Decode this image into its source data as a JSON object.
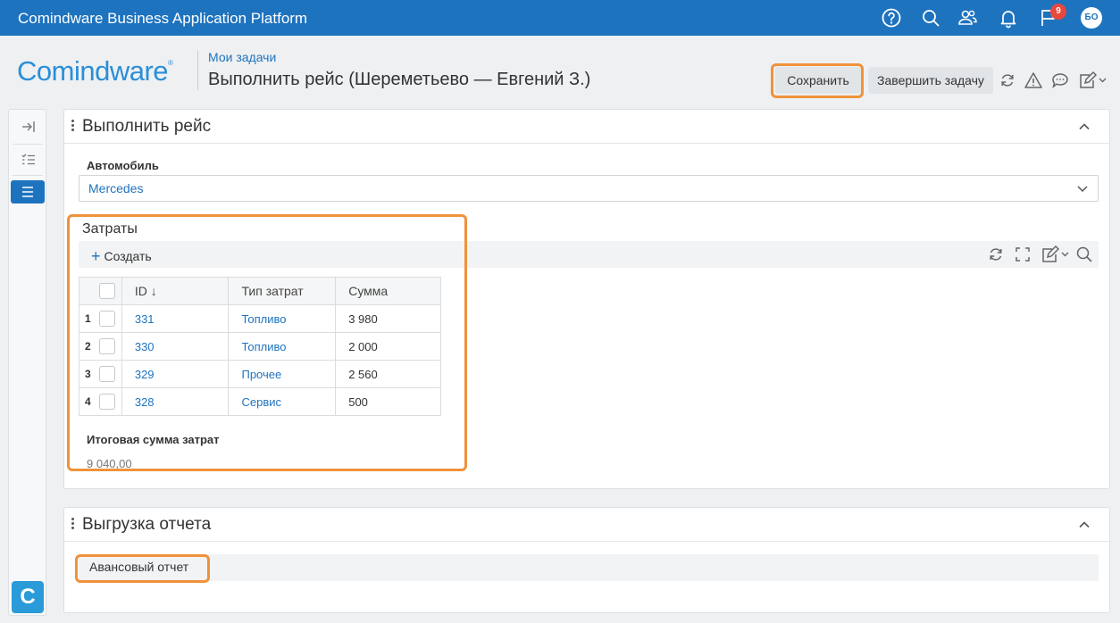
{
  "topbar": {
    "app_title": "Comindware Business Application Platform",
    "icons": [
      "help-icon",
      "search-icon",
      "users-icon",
      "bell-icon",
      "flag-icon"
    ],
    "notification_count": "9",
    "avatar_initials": "БО"
  },
  "header": {
    "logo": "Comindware",
    "breadcrumb": "Мои задачи",
    "title": "Выполнить рейс (Шереметьево — Евгений З.)",
    "save_label": "Сохранить",
    "complete_label": "Завершить задачу"
  },
  "form": {
    "section_title": "Выполнить рейс",
    "car_label": "Автомобиль",
    "car_value": "Mercedes",
    "expenses": {
      "title": "Затраты",
      "create_label": "Создать",
      "columns": [
        "ID",
        "Тип затрат",
        "Сумма"
      ],
      "sort_indicator": "↓",
      "rows": [
        {
          "n": "1",
          "id": "331",
          "type": "Топливо",
          "sum": "3 980"
        },
        {
          "n": "2",
          "id": "330",
          "type": "Топливо",
          "sum": "2 000"
        },
        {
          "n": "3",
          "id": "329",
          "type": "Прочее",
          "sum": "2 560"
        },
        {
          "n": "4",
          "id": "328",
          "type": "Сервис",
          "sum": "500"
        }
      ]
    },
    "total_label": "Итоговая сумма затрат",
    "total_value": "9 040,00"
  },
  "report": {
    "section_title": "Выгрузка отчета",
    "button_label": "Авансовый отчет"
  },
  "colors": {
    "topbar": "#1e73be",
    "accent": "#1e73be",
    "highlight": "#f0923b"
  }
}
